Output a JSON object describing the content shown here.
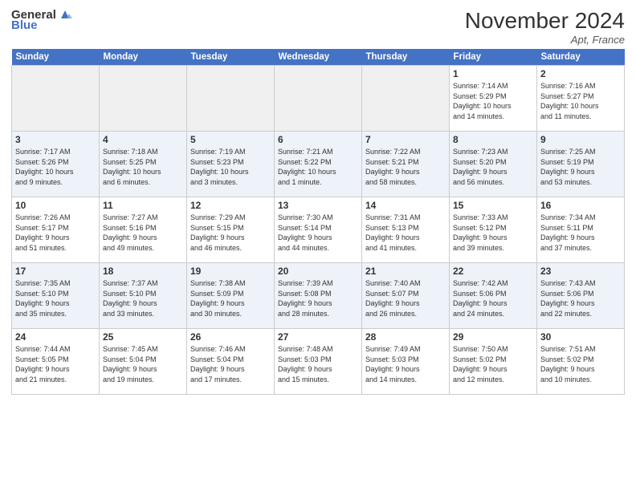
{
  "header": {
    "logo_general": "General",
    "logo_blue": "Blue",
    "title": "November 2024",
    "location": "Apt, France"
  },
  "weekdays": [
    "Sunday",
    "Monday",
    "Tuesday",
    "Wednesday",
    "Thursday",
    "Friday",
    "Saturday"
  ],
  "weeks": [
    {
      "alt": false,
      "days": [
        {
          "num": "",
          "info": "",
          "empty": true
        },
        {
          "num": "",
          "info": "",
          "empty": true
        },
        {
          "num": "",
          "info": "",
          "empty": true
        },
        {
          "num": "",
          "info": "",
          "empty": true
        },
        {
          "num": "",
          "info": "",
          "empty": true
        },
        {
          "num": "1",
          "info": "Sunrise: 7:14 AM\nSunset: 5:29 PM\nDaylight: 10 hours\nand 14 minutes.",
          "empty": false
        },
        {
          "num": "2",
          "info": "Sunrise: 7:16 AM\nSunset: 5:27 PM\nDaylight: 10 hours\nand 11 minutes.",
          "empty": false
        }
      ]
    },
    {
      "alt": true,
      "days": [
        {
          "num": "3",
          "info": "Sunrise: 7:17 AM\nSunset: 5:26 PM\nDaylight: 10 hours\nand 9 minutes.",
          "empty": false
        },
        {
          "num": "4",
          "info": "Sunrise: 7:18 AM\nSunset: 5:25 PM\nDaylight: 10 hours\nand 6 minutes.",
          "empty": false
        },
        {
          "num": "5",
          "info": "Sunrise: 7:19 AM\nSunset: 5:23 PM\nDaylight: 10 hours\nand 3 minutes.",
          "empty": false
        },
        {
          "num": "6",
          "info": "Sunrise: 7:21 AM\nSunset: 5:22 PM\nDaylight: 10 hours\nand 1 minute.",
          "empty": false
        },
        {
          "num": "7",
          "info": "Sunrise: 7:22 AM\nSunset: 5:21 PM\nDaylight: 9 hours\nand 58 minutes.",
          "empty": false
        },
        {
          "num": "8",
          "info": "Sunrise: 7:23 AM\nSunset: 5:20 PM\nDaylight: 9 hours\nand 56 minutes.",
          "empty": false
        },
        {
          "num": "9",
          "info": "Sunrise: 7:25 AM\nSunset: 5:19 PM\nDaylight: 9 hours\nand 53 minutes.",
          "empty": false
        }
      ]
    },
    {
      "alt": false,
      "days": [
        {
          "num": "10",
          "info": "Sunrise: 7:26 AM\nSunset: 5:17 PM\nDaylight: 9 hours\nand 51 minutes.",
          "empty": false
        },
        {
          "num": "11",
          "info": "Sunrise: 7:27 AM\nSunset: 5:16 PM\nDaylight: 9 hours\nand 49 minutes.",
          "empty": false
        },
        {
          "num": "12",
          "info": "Sunrise: 7:29 AM\nSunset: 5:15 PM\nDaylight: 9 hours\nand 46 minutes.",
          "empty": false
        },
        {
          "num": "13",
          "info": "Sunrise: 7:30 AM\nSunset: 5:14 PM\nDaylight: 9 hours\nand 44 minutes.",
          "empty": false
        },
        {
          "num": "14",
          "info": "Sunrise: 7:31 AM\nSunset: 5:13 PM\nDaylight: 9 hours\nand 41 minutes.",
          "empty": false
        },
        {
          "num": "15",
          "info": "Sunrise: 7:33 AM\nSunset: 5:12 PM\nDaylight: 9 hours\nand 39 minutes.",
          "empty": false
        },
        {
          "num": "16",
          "info": "Sunrise: 7:34 AM\nSunset: 5:11 PM\nDaylight: 9 hours\nand 37 minutes.",
          "empty": false
        }
      ]
    },
    {
      "alt": true,
      "days": [
        {
          "num": "17",
          "info": "Sunrise: 7:35 AM\nSunset: 5:10 PM\nDaylight: 9 hours\nand 35 minutes.",
          "empty": false
        },
        {
          "num": "18",
          "info": "Sunrise: 7:37 AM\nSunset: 5:10 PM\nDaylight: 9 hours\nand 33 minutes.",
          "empty": false
        },
        {
          "num": "19",
          "info": "Sunrise: 7:38 AM\nSunset: 5:09 PM\nDaylight: 9 hours\nand 30 minutes.",
          "empty": false
        },
        {
          "num": "20",
          "info": "Sunrise: 7:39 AM\nSunset: 5:08 PM\nDaylight: 9 hours\nand 28 minutes.",
          "empty": false
        },
        {
          "num": "21",
          "info": "Sunrise: 7:40 AM\nSunset: 5:07 PM\nDaylight: 9 hours\nand 26 minutes.",
          "empty": false
        },
        {
          "num": "22",
          "info": "Sunrise: 7:42 AM\nSunset: 5:06 PM\nDaylight: 9 hours\nand 24 minutes.",
          "empty": false
        },
        {
          "num": "23",
          "info": "Sunrise: 7:43 AM\nSunset: 5:06 PM\nDaylight: 9 hours\nand 22 minutes.",
          "empty": false
        }
      ]
    },
    {
      "alt": false,
      "days": [
        {
          "num": "24",
          "info": "Sunrise: 7:44 AM\nSunset: 5:05 PM\nDaylight: 9 hours\nand 21 minutes.",
          "empty": false
        },
        {
          "num": "25",
          "info": "Sunrise: 7:45 AM\nSunset: 5:04 PM\nDaylight: 9 hours\nand 19 minutes.",
          "empty": false
        },
        {
          "num": "26",
          "info": "Sunrise: 7:46 AM\nSunset: 5:04 PM\nDaylight: 9 hours\nand 17 minutes.",
          "empty": false
        },
        {
          "num": "27",
          "info": "Sunrise: 7:48 AM\nSunset: 5:03 PM\nDaylight: 9 hours\nand 15 minutes.",
          "empty": false
        },
        {
          "num": "28",
          "info": "Sunrise: 7:49 AM\nSunset: 5:03 PM\nDaylight: 9 hours\nand 14 minutes.",
          "empty": false
        },
        {
          "num": "29",
          "info": "Sunrise: 7:50 AM\nSunset: 5:02 PM\nDaylight: 9 hours\nand 12 minutes.",
          "empty": false
        },
        {
          "num": "30",
          "info": "Sunrise: 7:51 AM\nSunset: 5:02 PM\nDaylight: 9 hours\nand 10 minutes.",
          "empty": false
        }
      ]
    }
  ]
}
